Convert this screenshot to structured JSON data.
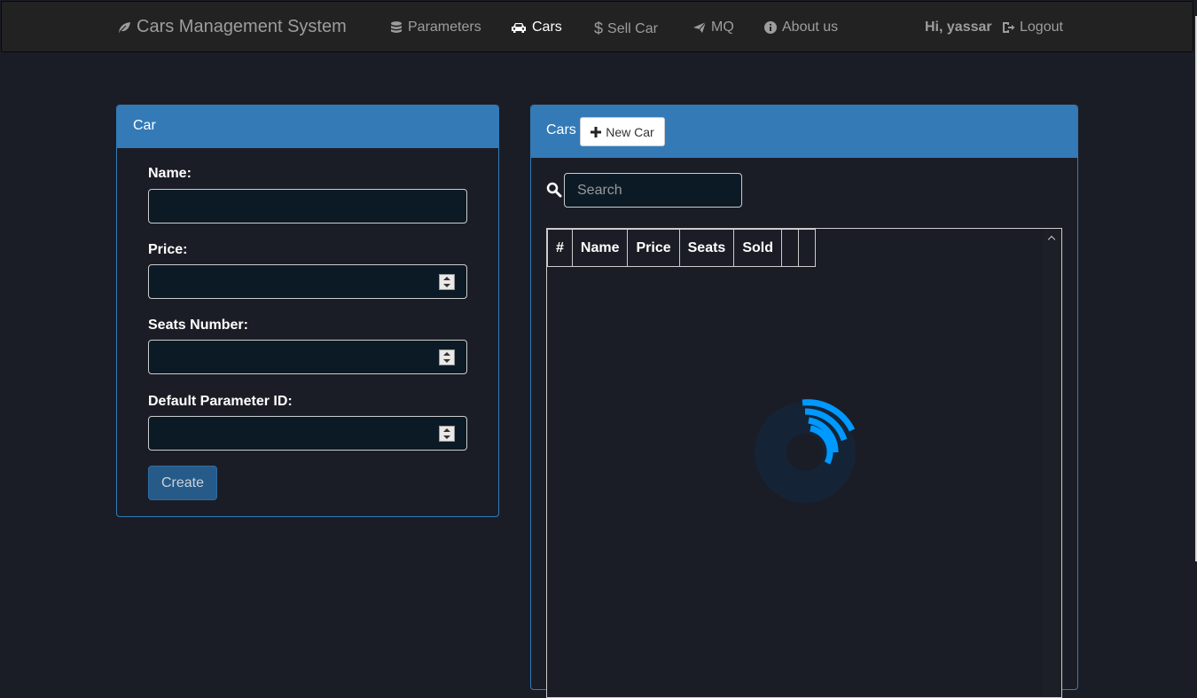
{
  "navbar": {
    "brand": "Cars Management System",
    "items": [
      {
        "label": "Parameters",
        "icon": "database-icon"
      },
      {
        "label": "Cars",
        "icon": "car-icon",
        "active": true
      },
      {
        "label": "Sell Car",
        "icon": "dollar-icon"
      },
      {
        "label": "MQ",
        "icon": "send-icon"
      },
      {
        "label": "About us",
        "icon": "info-icon"
      }
    ],
    "greeting_prefix": "Hi,",
    "username": "yassar",
    "logout_label": "Logout"
  },
  "car_form": {
    "title": "Car",
    "fields": [
      {
        "label": "Name:",
        "value": ""
      },
      {
        "label": "Price:",
        "value": ""
      },
      {
        "label": "Seats Number:",
        "value": ""
      },
      {
        "label": "Default Parameter ID:",
        "value": ""
      }
    ],
    "submit_label": "Create"
  },
  "cars_panel": {
    "title": "Cars",
    "new_button_label": "New Car",
    "search_placeholder": "Search",
    "columns": [
      "#",
      "Name",
      "Price",
      "Seats",
      "Sold",
      "",
      ""
    ]
  },
  "colors": {
    "primary": "#337ab7",
    "background": "#1b1d26",
    "navbar": "#222222",
    "spinner": "#0099ff"
  }
}
